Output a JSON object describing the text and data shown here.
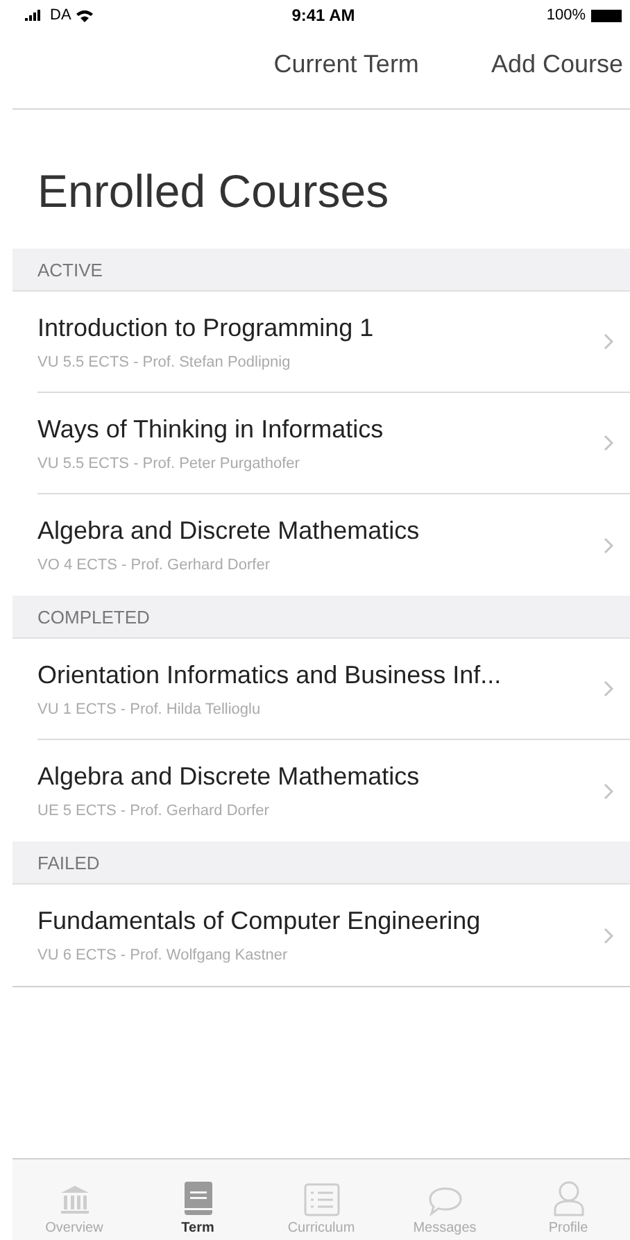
{
  "status_bar": {
    "carrier": "DA",
    "time": "9:41 AM",
    "battery": "100%"
  },
  "nav": {
    "items": [
      "Current Term",
      "Add Course"
    ]
  },
  "title": "Enrolled Courses",
  "sections": [
    {
      "header": "ACTIVE",
      "courses": [
        {
          "name": "Introduction to Programming 1",
          "details": "VU 5.5 ECTS - Prof. Stefan Podlipnig"
        },
        {
          "name": "Ways of Thinking in Informatics",
          "details": "VU 5.5 ECTS - Prof. Peter Purgathofer"
        },
        {
          "name": "Algebra and Discrete Mathematics",
          "details": "VO 4 ECTS - Prof. Gerhard Dorfer"
        }
      ]
    },
    {
      "header": "COMPLETED",
      "courses": [
        {
          "name": "Orientation Informatics and Business Inf...",
          "details": "VU 1 ECTS - Prof. Hilda Tellioglu"
        },
        {
          "name": "Algebra and Discrete Mathematics",
          "details": "UE 5 ECTS - Prof. Gerhard Dorfer"
        }
      ]
    },
    {
      "header": "FAILED",
      "courses": [
        {
          "name": "Fundamentals of Computer Engineering",
          "details": "VU 6 ECTS - Prof. Wolfgang Kastner"
        }
      ]
    }
  ],
  "tab_bar": [
    {
      "label": "Overview",
      "selected": false
    },
    {
      "label": "Term",
      "selected": true
    },
    {
      "label": "Curriculum",
      "selected": false
    },
    {
      "label": "Messages",
      "selected": false
    },
    {
      "label": "Profile",
      "selected": false
    }
  ]
}
